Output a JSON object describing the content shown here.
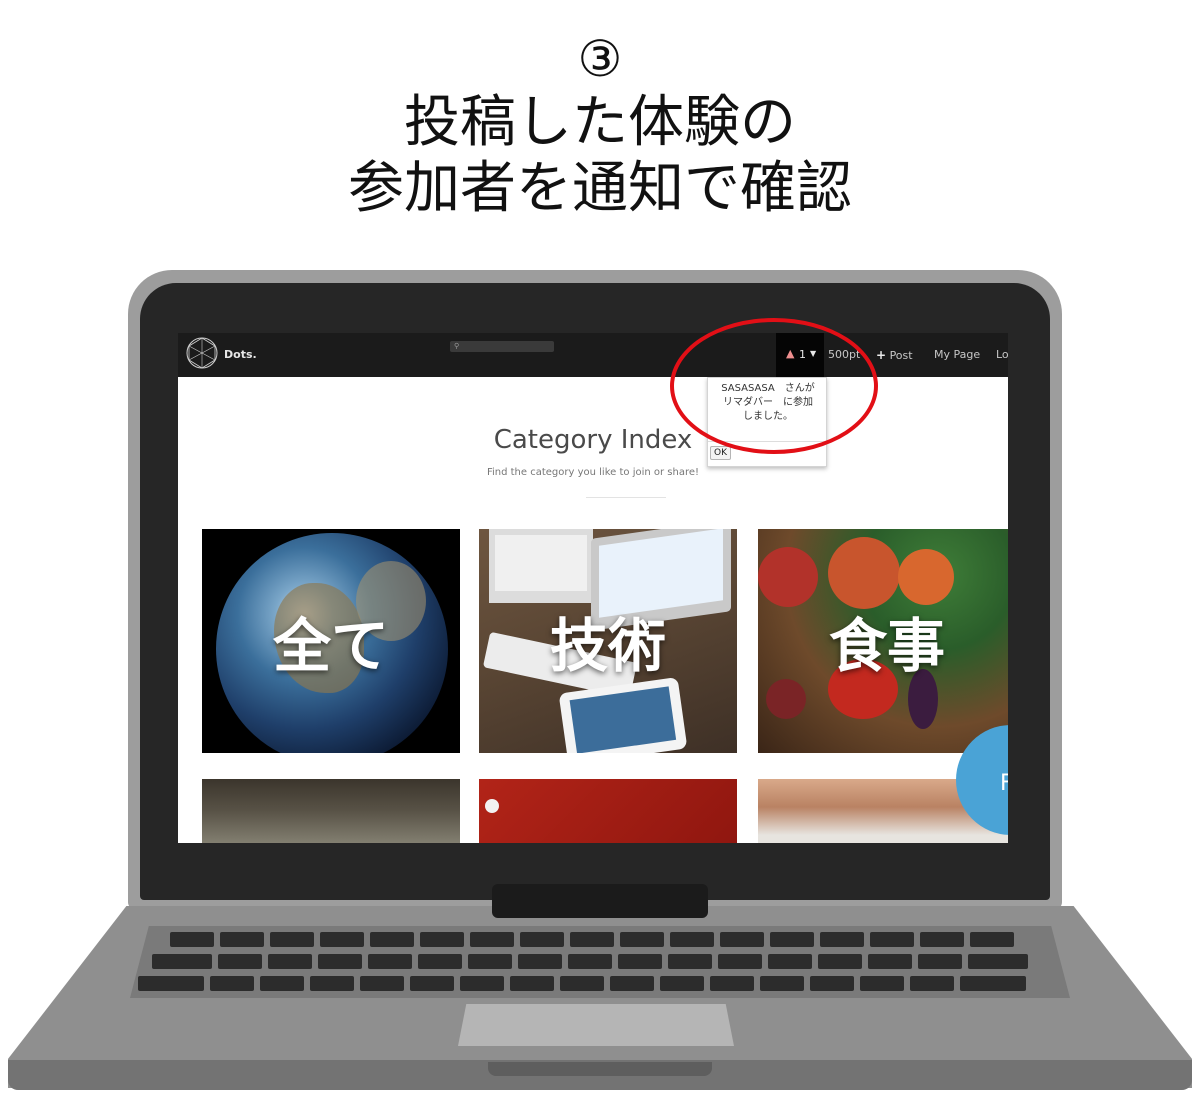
{
  "heading": {
    "step": "③",
    "line1": "投稿した体験の",
    "line2": "参加者を通知で確認"
  },
  "app": {
    "brand": "Dots.",
    "nav": {
      "notification_count": "1",
      "points": "500pt",
      "post": "Post",
      "my_page": "My Page",
      "logout_partial": "Lo"
    },
    "notification_popup": {
      "message": "SASASASA　さんが\nリマダバー　に参加\nしました。",
      "ok": "OK"
    },
    "main": {
      "title": "Category Index",
      "subtitle": "Find the category you like to join or share!"
    },
    "categories": [
      {
        "label": "全て"
      },
      {
        "label": "技術"
      },
      {
        "label": "食事"
      },
      {
        "label": ""
      },
      {
        "label": ""
      },
      {
        "label": ""
      }
    ],
    "floating_button": {
      "label": "F"
    }
  },
  "colors": {
    "highlight": "#e20f16",
    "navbar": "#1b1b1b",
    "floating_button": "#4aa3d6"
  },
  "icons": [
    "bell-icon",
    "caret-down-icon",
    "plus-icon",
    "search-icon",
    "logo-icon"
  ]
}
